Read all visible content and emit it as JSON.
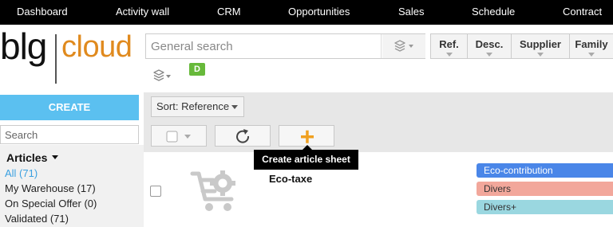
{
  "nav": {
    "items": [
      "Dashboard",
      "Activity wall",
      "CRM",
      "Opportunities",
      "Sales",
      "Schedule",
      "Contract"
    ]
  },
  "logo": {
    "part1": "blg",
    "part2": "cloud"
  },
  "search": {
    "placeholder": "General search",
    "value": ""
  },
  "badge": {
    "label": "D",
    "color": "#67b93a"
  },
  "columns": [
    "Ref.",
    "Desc.",
    "Supplier",
    "Family"
  ],
  "sidebar": {
    "create_label": "CREATE",
    "search_placeholder": "Search",
    "section_title": "Articles",
    "items": [
      {
        "label": "All (71)",
        "active": true
      },
      {
        "label": "My Warehouse (17)",
        "active": false
      },
      {
        "label": "On Special Offer (0)",
        "active": false
      },
      {
        "label": "Validated (71)",
        "active": false
      }
    ]
  },
  "toolbar": {
    "sort_label": "Sort: Reference",
    "tooltip": "Create article sheet",
    "add_color": "#f0a020"
  },
  "article": {
    "name": "Eco-taxe",
    "tags": [
      {
        "label": "Eco-contribution",
        "bg": "#4a86e8",
        "fg": "#ffffff"
      },
      {
        "label": "Divers",
        "bg": "#f2a79b",
        "fg": "#333333"
      },
      {
        "label": "Divers+",
        "bg": "#9ad7e0",
        "fg": "#333333"
      }
    ]
  },
  "colors": {
    "accent": "#5bc0f0",
    "logo_orange": "#e08a1e",
    "active_link": "#3aa0e0"
  }
}
